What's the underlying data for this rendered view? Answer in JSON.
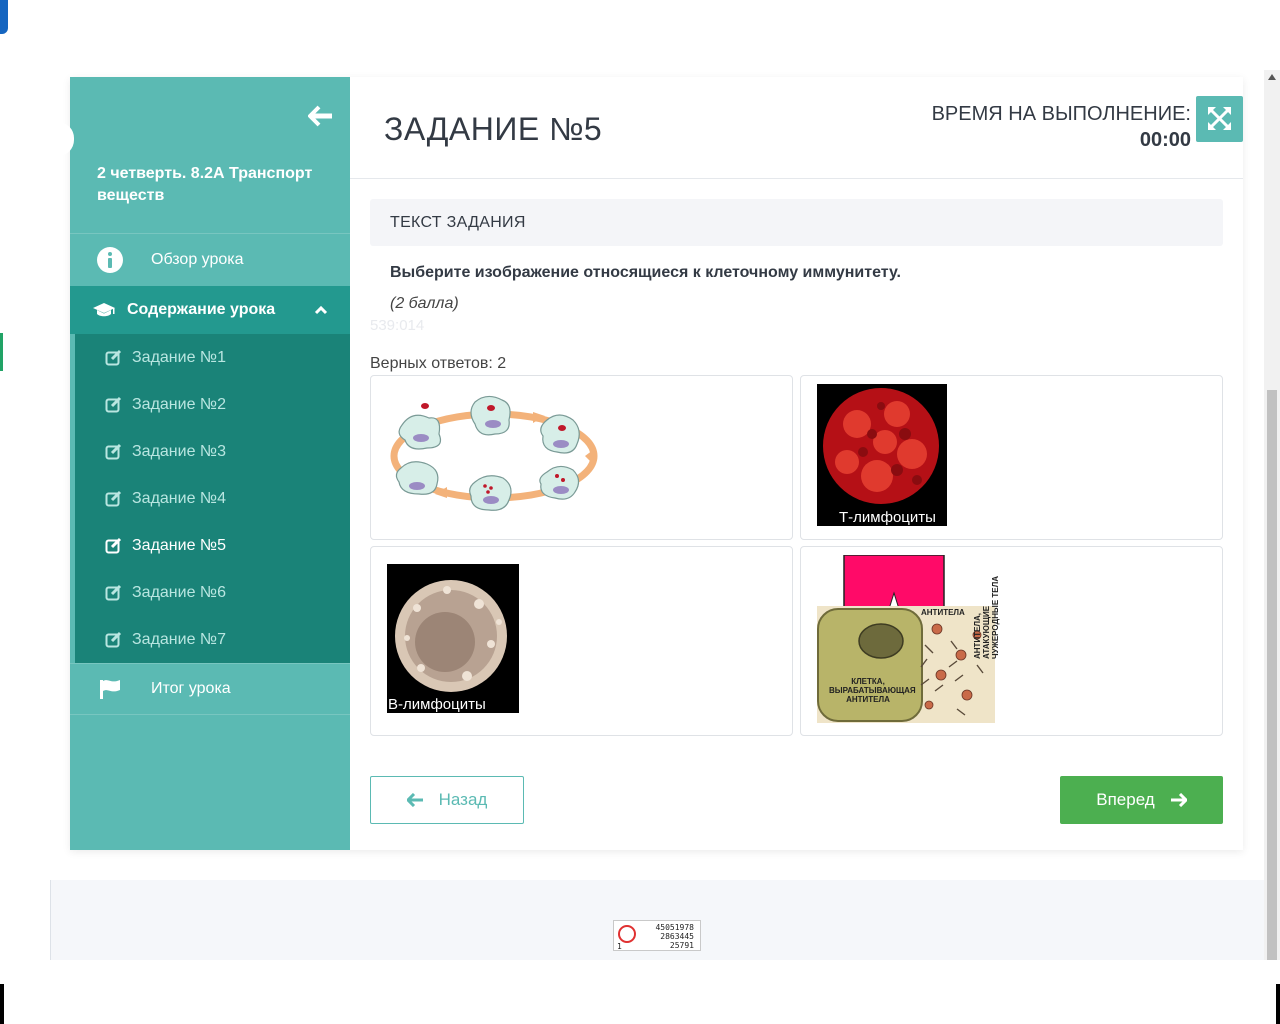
{
  "sidebar": {
    "course_title": "2 четверть. 8.2А Транспорт веществ",
    "overview_label": "Обзор урока",
    "content_label": "Содержание урока",
    "tasks": [
      {
        "label": "Задание №1"
      },
      {
        "label": "Задание №2"
      },
      {
        "label": "Задание №3"
      },
      {
        "label": "Задание №4"
      },
      {
        "label": "Задание №5"
      },
      {
        "label": "Задание №6"
      },
      {
        "label": "Задание №7"
      }
    ],
    "active_task_index": 4,
    "summary_label": "Итог урока"
  },
  "task": {
    "title": "ЗАДАНИЕ №5",
    "timer_label": "ВРЕМЯ НА ВЫПОЛНЕНИЕ:",
    "timer_value": "00:00",
    "text_header": "ТЕКСТ ЗАДАНИЯ",
    "question": "Выберите изображение относящиеся к клеточному иммунитету.",
    "points": "(2 балла)",
    "faded_code": "539:014",
    "correct_count": "Верных ответов: 2"
  },
  "options": [
    {
      "caption": ""
    },
    {
      "caption": "Т-лимфоциты"
    },
    {
      "caption": "В-лимфоциты"
    },
    {
      "caption": "",
      "label_top": "АНТИТЕЛА",
      "label_cell": "КЛЕТКА, ВЫРАБАТЫВАЮЩАЯ АНТИТЕЛА",
      "label_side": "АНТИТЕЛА, АТАКУЮЩИЕ ЧУЖЕРОДНЫЕ ТЕЛА"
    }
  ],
  "nav": {
    "back_label": "Назад",
    "next_label": "Вперед"
  },
  "counter": {
    "line1": "45051978",
    "line2": "2863445",
    "line3": "25791",
    "left": "1"
  },
  "colors": {
    "sidebar": "#5bbab3",
    "sidebar_active": "#23998f",
    "sublist": "#1a8378",
    "next_button": "#4caf50"
  }
}
